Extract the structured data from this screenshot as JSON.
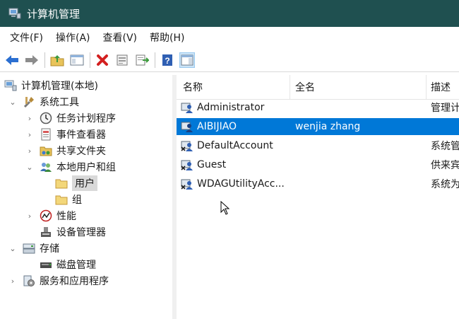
{
  "window": {
    "title": "计算机管理"
  },
  "menu": [
    "文件(F)",
    "操作(A)",
    "查看(V)",
    "帮助(H)"
  ],
  "toolbar": [
    {
      "icon": "back-arrow-icon"
    },
    {
      "icon": "forward-arrow-icon"
    },
    {
      "icon": "up-folder-icon"
    },
    {
      "icon": "show-hide-tree-icon"
    },
    {
      "icon": "delete-icon"
    },
    {
      "icon": "properties-icon"
    },
    {
      "icon": "export-list-icon"
    },
    {
      "icon": "help-icon"
    },
    {
      "icon": "action-pane-icon"
    }
  ],
  "tree": {
    "root": "计算机管理(本地)",
    "system_tools": "系统工具",
    "task_scheduler": "任务计划程序",
    "event_viewer": "事件查看器",
    "shared_folders": "共享文件夹",
    "local_users": "本地用户和组",
    "users": "用户",
    "groups": "组",
    "performance": "性能",
    "device_manager": "设备管理器",
    "storage": "存储",
    "disk_management": "磁盘管理",
    "services_apps": "服务和应用程序"
  },
  "list": {
    "columns": [
      "名称",
      "全名",
      "描述"
    ],
    "rows": [
      {
        "name": "Administrator",
        "fullname": "",
        "desc": "管理计"
      },
      {
        "name": "AIBIJIAO",
        "fullname": "wenjia zhang",
        "desc": "",
        "selected": true
      },
      {
        "name": "DefaultAccount",
        "fullname": "",
        "desc": "系统管"
      },
      {
        "name": "Guest",
        "fullname": "",
        "desc": "供来宾"
      },
      {
        "name": "WDAGUtilityAcc...",
        "fullname": "",
        "desc": "系统为"
      }
    ]
  },
  "colors": {
    "titlebar": "#1f5050",
    "selection": "#0078d7"
  }
}
